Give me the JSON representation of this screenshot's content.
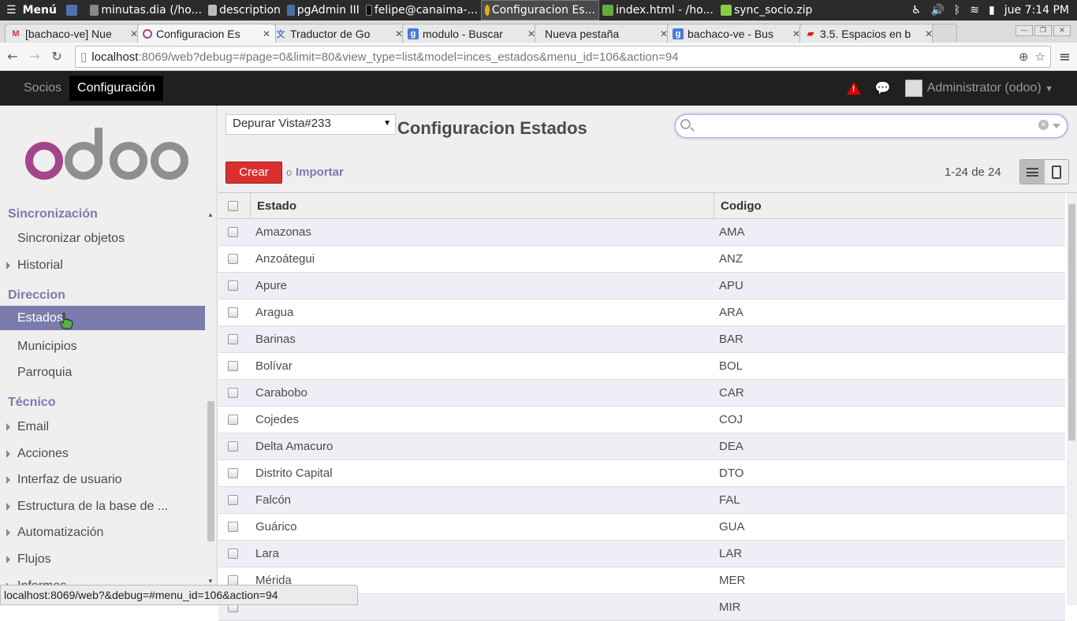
{
  "taskbar": {
    "menu_label": "Menú",
    "items": [
      {
        "label": "minutas.dia (/ho..."
      },
      {
        "label": "description"
      },
      {
        "label": "pgAdmin III"
      },
      {
        "label": "felipe@canaima-..."
      },
      {
        "label": "Configuracion Es..."
      },
      {
        "label": "index.html - /ho..."
      },
      {
        "label": "sync_socio.zip"
      }
    ],
    "clock": "jue  7:14 PM"
  },
  "browser_tabs": [
    {
      "label": "[bachaco-ve] Nue",
      "icon": "gmail-icon"
    },
    {
      "label": "Configuracion Es",
      "icon": "odoo-icon"
    },
    {
      "label": "Traductor de Go",
      "icon": "translate-icon"
    },
    {
      "label": "modulo - Buscar",
      "icon": "google-icon"
    },
    {
      "label": "Nueva pestaña",
      "icon": ""
    },
    {
      "label": "bachaco-ve - Bus",
      "icon": "google-icon"
    },
    {
      "label": "3.5. Espacios en b",
      "icon": "book-icon"
    }
  ],
  "url": {
    "host": "localhost",
    "rest": ":8069/web?debug=#page=0&limit=80&view_type=list&model=inces_estados&menu_id=106&action=94"
  },
  "odoo_top": {
    "menus": [
      "Socios",
      "Configuración"
    ],
    "user": "Administrator (odoo)"
  },
  "sidebar": {
    "logo_text": "odoo",
    "sections": [
      {
        "title": "Sincronización",
        "items": [
          {
            "label": "Sincronizar objetos",
            "expandable": false
          },
          {
            "label": "Historial",
            "expandable": true
          }
        ]
      },
      {
        "title": "Direccion",
        "items": [
          {
            "label": "Estados",
            "expandable": false,
            "selected": true
          },
          {
            "label": "Municipios",
            "expandable": false
          },
          {
            "label": "Parroquia",
            "expandable": false
          }
        ]
      },
      {
        "title": "Técnico",
        "items": [
          {
            "label": "Email",
            "expandable": true
          },
          {
            "label": "Acciones",
            "expandable": true
          },
          {
            "label": "Interfaz de usuario",
            "expandable": true
          },
          {
            "label": "Estructura de la base de ...",
            "expandable": true
          },
          {
            "label": "Automatización",
            "expandable": true
          },
          {
            "label": "Flujos",
            "expandable": true
          },
          {
            "label": "Informes",
            "expandable": true
          }
        ]
      }
    ]
  },
  "control_panel": {
    "debug_select": "Depurar Vista#233",
    "title": "Configuracion Estados",
    "search_placeholder": "",
    "create_label": "Crear",
    "or_label": "o",
    "import_label": "Importar",
    "pager": "1-24 de 24"
  },
  "table": {
    "columns": [
      "Estado",
      "Codigo"
    ],
    "rows": [
      [
        "Amazonas",
        "AMA"
      ],
      [
        "Anzoátegui",
        "ANZ"
      ],
      [
        "Apure",
        "APU"
      ],
      [
        "Aragua",
        "ARA"
      ],
      [
        "Barinas",
        "BAR"
      ],
      [
        "Bolívar",
        "BOL"
      ],
      [
        "Carabobo",
        "CAR"
      ],
      [
        "Cojedes",
        "COJ"
      ],
      [
        "Delta Amacuro",
        "DEA"
      ],
      [
        "Distrito Capital",
        "DTO"
      ],
      [
        "Falcón",
        "FAL"
      ],
      [
        "Guárico",
        "GUA"
      ],
      [
        "Lara",
        "LAR"
      ],
      [
        "Mérida",
        "MER"
      ],
      [
        "",
        "MIR"
      ]
    ]
  },
  "status_url": "localhost:8069/web?&debug=#menu_id=106&action=94",
  "colors": {
    "odoo_purple": "#7c7bad",
    "create_red": "#dc3030",
    "topbar": "#202020"
  }
}
